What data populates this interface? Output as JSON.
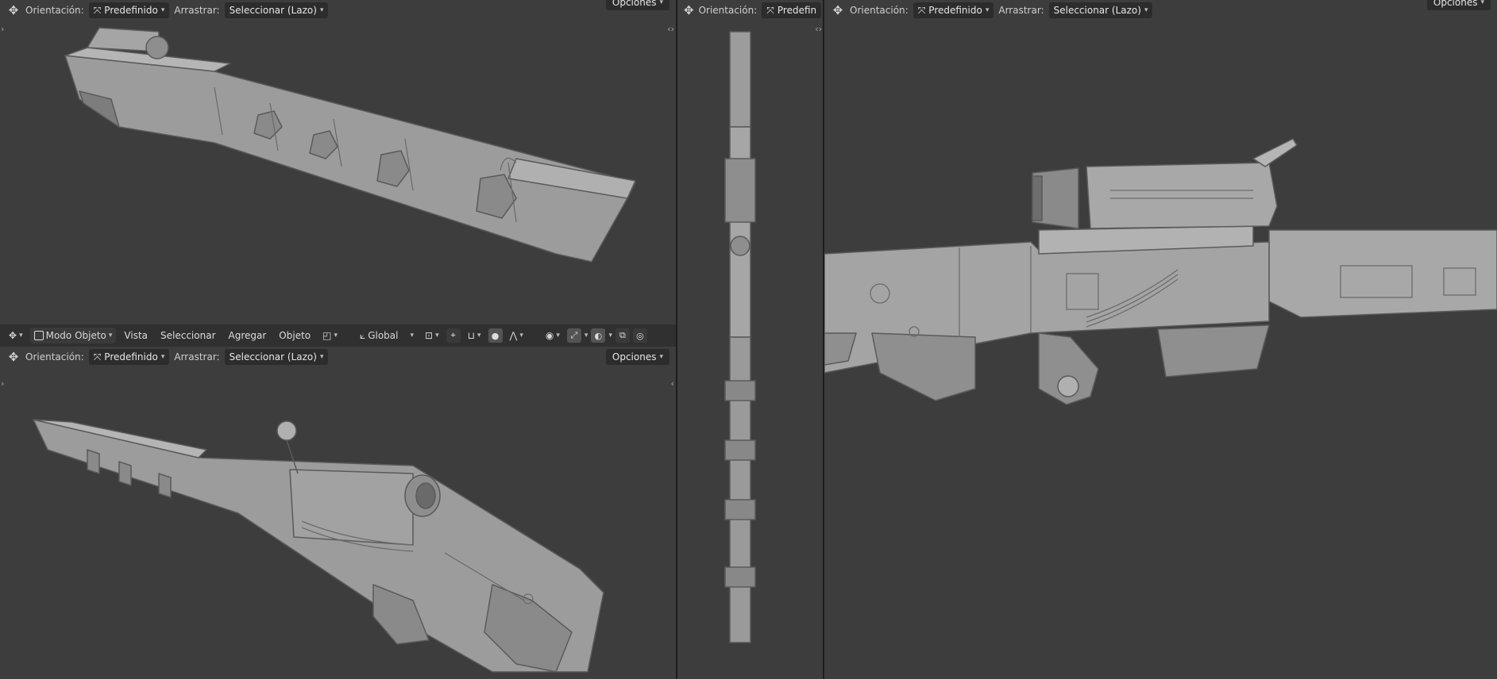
{
  "viewport_toolbar": {
    "orientation_label": "Orientación:",
    "orientation_value": "Predefinido",
    "drag_label": "Arrastrar:",
    "drag_value": "Seleccionar (Lazo)",
    "options_label": "Opciones",
    "orientation_value_truncated": "Predefin"
  },
  "editor_header": {
    "mode_label": "Modo Objeto",
    "menus": [
      "Vista",
      "Seleccionar",
      "Agregar",
      "Objeto"
    ],
    "transform_orientation": "Global"
  },
  "icons": {
    "move": "move-arrows-icon",
    "orientation": "transform-orientation-icon",
    "mode": "object-mode-icon",
    "snap": "snap-icon",
    "proportional": "proportional-edit-icon",
    "visibility": "visibility-eye-icon",
    "gizmo": "gizmo-icon",
    "overlay": "overlay-icon",
    "xray": "xray-icon"
  },
  "colors": {
    "viewport_bg": "#3d3d3d",
    "header_bg": "#303030",
    "model": "#9a9a9a"
  }
}
